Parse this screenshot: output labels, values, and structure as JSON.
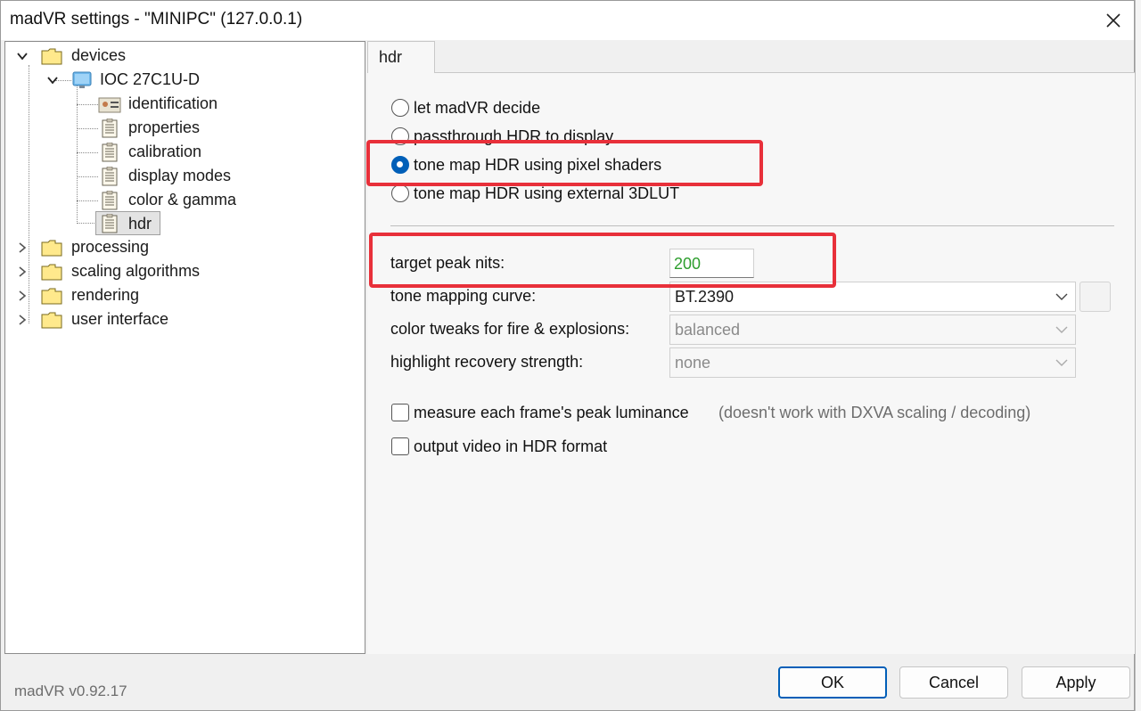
{
  "window": {
    "title": "madVR settings - \"MINIPC\" (127.0.0.1)",
    "version": "madVR v0.92.17"
  },
  "tree": {
    "devices": "devices",
    "device_name": "IOC 27C1U-D",
    "device_children": [
      "identification",
      "properties",
      "calibration",
      "display modes",
      "color & gamma",
      "hdr"
    ],
    "selected": "hdr",
    "top_level": [
      "processing",
      "scaling algorithms",
      "rendering",
      "user interface"
    ]
  },
  "tab": {
    "label": "hdr"
  },
  "hdr_mode": {
    "options": [
      "let madVR decide",
      "passthrough HDR to display",
      "tone map HDR using pixel shaders",
      "tone map HDR using external 3DLUT"
    ],
    "selected": "tone map HDR using pixel shaders"
  },
  "settings": {
    "target_peak_nits_label": "target peak nits:",
    "target_peak_nits_value": "200",
    "tone_mapping_curve_label": "tone mapping curve:",
    "tone_mapping_curve_value": "BT.2390",
    "color_tweaks_label": "color tweaks for fire & explosions:",
    "color_tweaks_value": "balanced",
    "highlight_recovery_label": "highlight recovery strength:",
    "highlight_recovery_value": "none"
  },
  "checkboxes": {
    "measure_peak_label": "measure each frame's peak luminance",
    "measure_peak_note": "(doesn't work with DXVA scaling / decoding)",
    "output_hdr_label": "output video in HDR format"
  },
  "buttons": {
    "ok": "OK",
    "cancel": "Cancel",
    "apply": "Apply"
  },
  "colors": {
    "accent": "#005fb8",
    "highlight": "#e8303a",
    "nits_text": "#2e9e2e"
  }
}
